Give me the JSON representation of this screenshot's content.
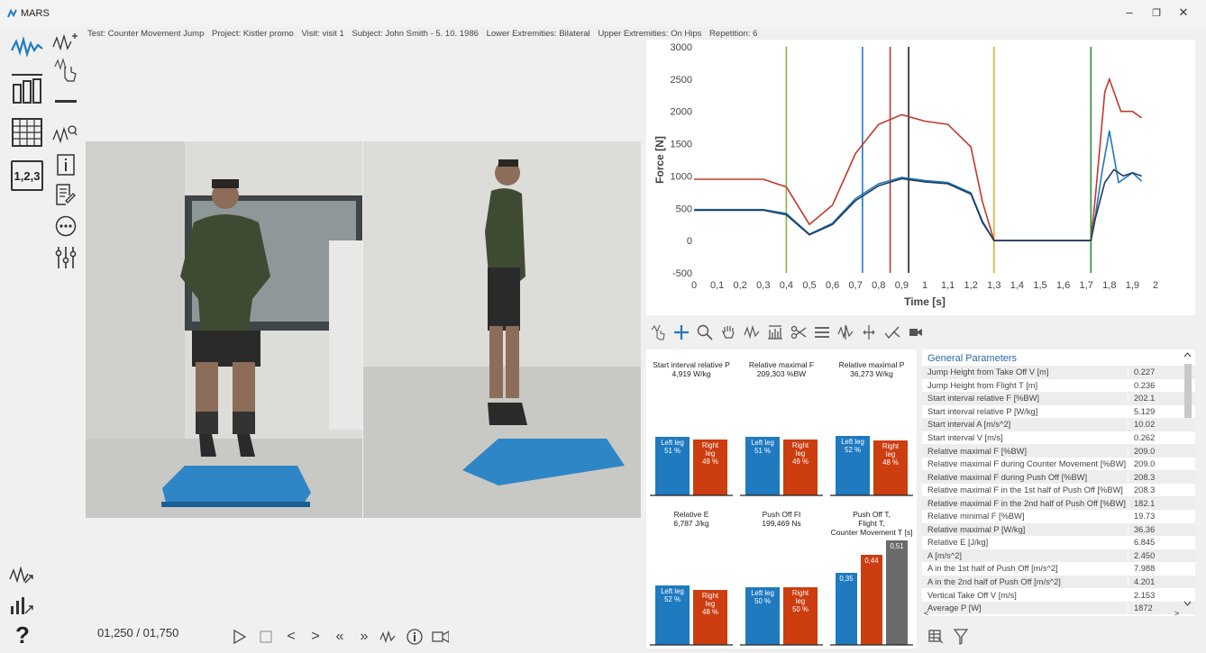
{
  "window": {
    "title": "MARS",
    "minimize": "–",
    "restore": "❐",
    "close": "✕"
  },
  "info": {
    "test": "Test: Counter Movement Jump",
    "project": "Project: Kistler promo",
    "visit": "Visit: visit 1",
    "subject": "Subject: John Smith - 5. 10. 1986",
    "lower": "Lower Extremities: Bilateral",
    "upper": "Upper Extremities: On Hips",
    "repetition": "Repetition: 6"
  },
  "left_tools": {
    "table_label": "1,2,3"
  },
  "playback": {
    "frame": "01,250 / 01,750"
  },
  "chart_data": {
    "type": "line",
    "xlabel": "Time [s]",
    "ylabel": "Force [N]",
    "xlim": [
      0,
      2
    ],
    "ylim": [
      -500,
      3000
    ],
    "xticks": [
      "0",
      "0,1",
      "0,2",
      "0,3",
      "0,4",
      "0,5",
      "0,6",
      "0,7",
      "0,8",
      "0,9",
      "1",
      "1,1",
      "1,2",
      "1,3",
      "1,4",
      "1,5",
      "1,6",
      "1,7",
      "1,8",
      "1,9",
      "2"
    ],
    "yticks": [
      "3000",
      "2500",
      "2000",
      "1500",
      "1000",
      "500",
      "0",
      "-500"
    ],
    "markers": [
      {
        "x": 0.4,
        "color": "#8ab040"
      },
      {
        "x": 0.73,
        "color": "#1f7ac0"
      },
      {
        "x": 0.85,
        "color": "#c0392b"
      },
      {
        "x": 0.93,
        "color": "#222222"
      },
      {
        "x": 1.3,
        "color": "#e0b030"
      },
      {
        "x": 1.72,
        "color": "#2e8b3a"
      }
    ],
    "series": [
      {
        "color": "#c0392b",
        "x": [
          0,
          0.3,
          0.4,
          0.5,
          0.6,
          0.7,
          0.8,
          0.9,
          1.0,
          1.1,
          1.2,
          1.25,
          1.3,
          1.72,
          1.74,
          1.78,
          1.8,
          1.85,
          1.9,
          1.94
        ],
        "y": [
          950,
          950,
          830,
          250,
          550,
          1350,
          1800,
          1950,
          1850,
          1800,
          1450,
          600,
          0,
          0,
          700,
          2300,
          2500,
          2000,
          2000,
          1900
        ]
      },
      {
        "color": "#1f7ac0",
        "x": [
          0,
          0.3,
          0.4,
          0.5,
          0.6,
          0.7,
          0.8,
          0.9,
          1.0,
          1.1,
          1.2,
          1.25,
          1.3,
          1.72,
          1.74,
          1.77,
          1.8,
          1.84,
          1.9,
          1.94
        ],
        "y": [
          480,
          480,
          420,
          100,
          270,
          650,
          880,
          980,
          930,
          900,
          740,
          300,
          0,
          0,
          400,
          1100,
          1700,
          900,
          1050,
          920
        ]
      },
      {
        "color": "#203a5a",
        "x": [
          0,
          0.3,
          0.4,
          0.5,
          0.6,
          0.7,
          0.8,
          0.9,
          1.0,
          1.1,
          1.2,
          1.25,
          1.3,
          1.72,
          1.74,
          1.78,
          1.82,
          1.86,
          1.9,
          1.94
        ],
        "y": [
          470,
          470,
          400,
          90,
          250,
          620,
          850,
          960,
          910,
          880,
          720,
          280,
          0,
          0,
          350,
          900,
          1100,
          1000,
          1050,
          1000
        ]
      }
    ]
  },
  "bar_cards": [
    {
      "title": "Start interval relative P",
      "value": "4,919 W/kg",
      "bars": [
        {
          "label": "Left leg\n51 %",
          "color": "#1f7ac0",
          "h": 65
        },
        {
          "label": "Right\nleg\n49 %",
          "color": "#cc3d10",
          "h": 62
        }
      ]
    },
    {
      "title": "Relative maximal F",
      "value": "209,303 %BW",
      "bars": [
        {
          "label": "Left leg\n51 %",
          "color": "#1f7ac0",
          "h": 65
        },
        {
          "label": "Right\nleg\n49 %",
          "color": "#cc3d10",
          "h": 62
        }
      ]
    },
    {
      "title": "Relative maximal P",
      "value": "36,273 W/kg",
      "bars": [
        {
          "label": "Left leg\n52 %",
          "color": "#1f7ac0",
          "h": 66
        },
        {
          "label": "Right\nleg\n48 %",
          "color": "#cc3d10",
          "h": 61
        }
      ]
    },
    {
      "title": "Relative E",
      "value": "6,787 J/kg",
      "bars": [
        {
          "label": "Left leg\n52 %",
          "color": "#1f7ac0",
          "h": 66
        },
        {
          "label": "Right\nleg\n48 %",
          "color": "#cc3d10",
          "h": 61
        }
      ]
    },
    {
      "title": "Push Off FI",
      "value": "199,469 Ns",
      "bars": [
        {
          "label": "Left leg\n50 %",
          "color": "#1f7ac0",
          "h": 64
        },
        {
          "label": "Right\nleg\n50 %",
          "color": "#cc3d10",
          "h": 64
        }
      ]
    },
    {
      "title": "Push Off T,\nFlight T,\nCounter Movement T [s]",
      "value": "",
      "bars": [
        {
          "label": "0,35",
          "color": "#1f7ac0",
          "h": 80
        },
        {
          "label": "0,44",
          "color": "#cc3d10",
          "h": 100
        },
        {
          "label": "0,51",
          "color": "#6b6b6b",
          "h": 116
        }
      ]
    }
  ],
  "params": {
    "header": "General Parameters",
    "rows": [
      {
        "label": "Jump Height from Take Off V [m]",
        "value": "0.227"
      },
      {
        "label": "Jump Height from Flight T [m]",
        "value": "0.236"
      },
      {
        "label": "Start interval relative F [%BW]",
        "value": "202.1"
      },
      {
        "label": "Start interval relative P [W/kg]",
        "value": "5.129"
      },
      {
        "label": "Start interval A [m/s^2]",
        "value": "10.02"
      },
      {
        "label": "Start interval V [m/s]",
        "value": "0.262"
      },
      {
        "label": "Relative maximal F [%BW]",
        "value": "209.0"
      },
      {
        "label": "Relative maximal F during Counter Movement [%BW]",
        "value": "209.0"
      },
      {
        "label": "Relative maximal F during Push Off [%BW]",
        "value": "208.3"
      },
      {
        "label": "Relative maximal F in the 1st half of Push Off [%BW]",
        "value": "208.3"
      },
      {
        "label": "Relative maximal F in the 2nd half of Push Off [%BW]",
        "value": "182.1"
      },
      {
        "label": "Relative minimal F [%BW]",
        "value": "19.73"
      },
      {
        "label": "Relative maximal P [W/kg]",
        "value": "36.36"
      },
      {
        "label": "Relative E [J/kg]",
        "value": "6.845"
      },
      {
        "label": "A [m/s^2]",
        "value": "2.450"
      },
      {
        "label": "A in the 1st half of Push Off [m/s^2]",
        "value": "7.988"
      },
      {
        "label": "A in the 2nd half of Push Off [m/s^2]",
        "value": "4.201"
      },
      {
        "label": "Vertical Take Off V [m/s]",
        "value": "2.153"
      },
      {
        "label": "Average P [W]",
        "value": "1872"
      }
    ]
  }
}
